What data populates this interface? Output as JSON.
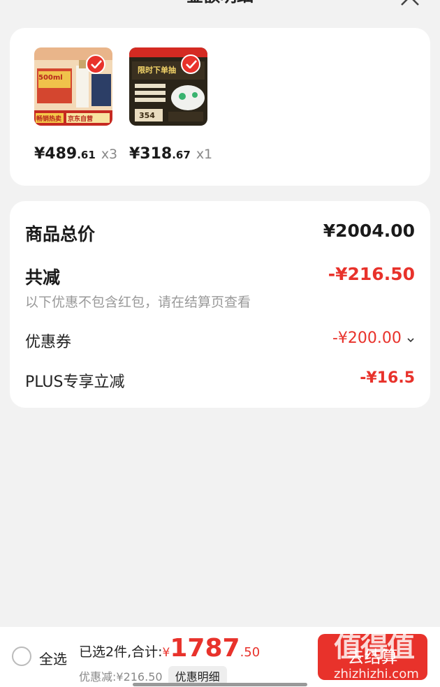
{
  "header": {
    "title": "金额明细"
  },
  "products": [
    {
      "price_int": "¥489",
      "price_dec": ".61",
      "qty": "x3",
      "image_text": [
        "500ml",
        "畅销热卖",
        "京东自营"
      ]
    },
    {
      "price_int": "¥318",
      "price_dec": ".67",
      "qty": "x1",
      "image_text": [
        "限时下单抽",
        "354"
      ]
    }
  ],
  "summary": {
    "total_label": "商品总价",
    "total_value": "¥2004.00",
    "reduce_label": "共减",
    "reduce_value": "-¥216.50",
    "note": "以下优惠不包含红包，请在结算页查看",
    "coupon_label": "优惠券",
    "coupon_value": "-¥200.00",
    "plus_label": "PLUS专享立减",
    "plus_value": "-¥16.5"
  },
  "bottom": {
    "select_all": "全选",
    "selected_label": "已选2件,合计:",
    "currency": "¥",
    "sum_int": "1787",
    "sum_dec": ".50",
    "discount": "优惠减:¥216.50",
    "detail_button": "优惠明细",
    "checkout": "去结算"
  },
  "watermark": {
    "big": "值得值",
    "small": "zhizhizhi.com"
  },
  "colors": {
    "accent": "#e8322b",
    "background": "#f2f2f2"
  }
}
